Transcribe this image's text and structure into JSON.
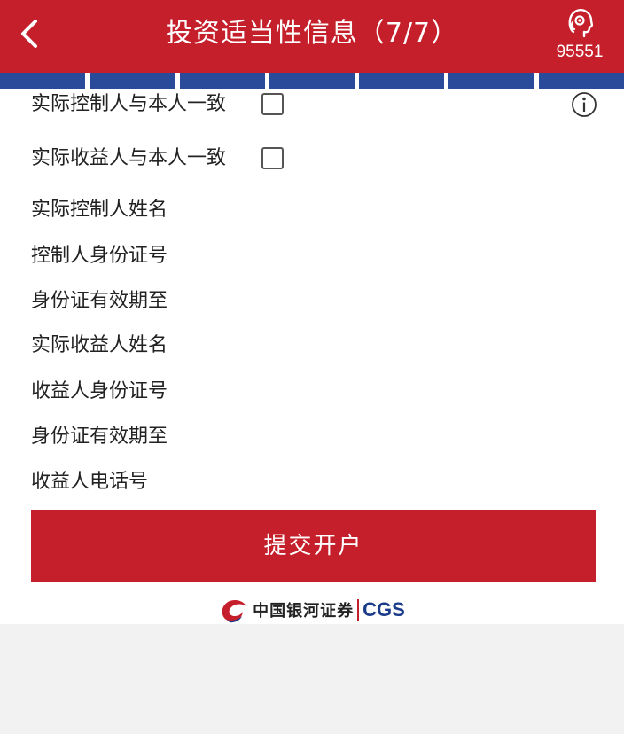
{
  "header": {
    "title": "投资适当性信息（7/7）",
    "hotline": "95551"
  },
  "progress": {
    "total_steps": 7,
    "current_step": 7
  },
  "form": {
    "controller_same_label": "实际控制人与本人一致",
    "beneficiary_same_label": "实际收益人与本人一致",
    "fields": [
      "实际控制人姓名",
      "控制人身份证号",
      "身份证有效期至",
      "实际收益人姓名",
      "收益人身份证号",
      "身份证有效期至",
      "收益人电话号"
    ]
  },
  "submit_label": "提交开户",
  "brand": {
    "name_cn": "中国银河证券",
    "name_en": "CGS"
  },
  "colors": {
    "primary_red": "#c41f2a",
    "progress_blue": "#2a4a9a"
  }
}
